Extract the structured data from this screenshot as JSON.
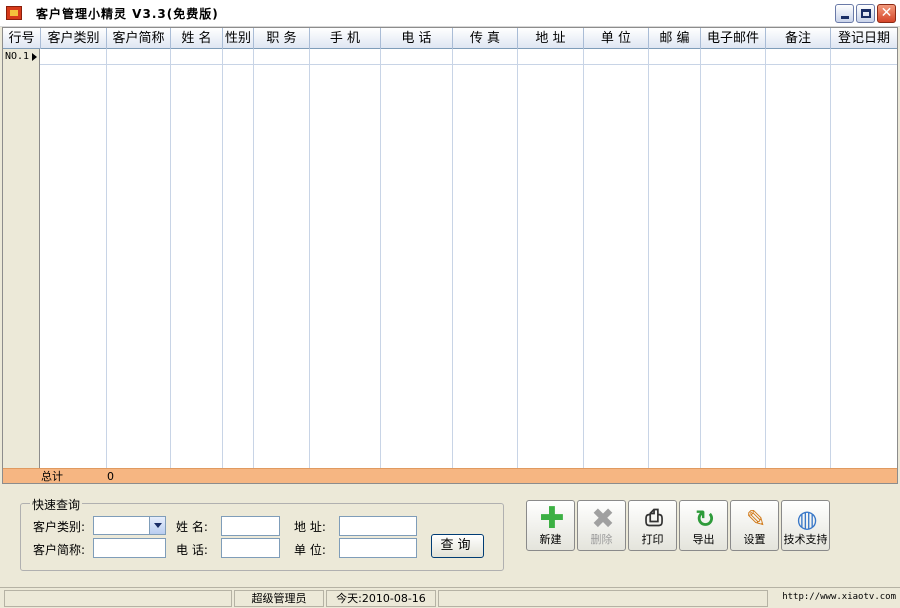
{
  "window": {
    "title": "客户管理小精灵 V3.3(免费版)",
    "icon": "app-icon",
    "controls": [
      "minimize-icon",
      "maximize-icon",
      "close-icon"
    ]
  },
  "grid": {
    "columns": [
      "行号",
      "客户类别",
      "客户简称",
      "姓 名",
      "性别",
      "职 务",
      "手 机",
      "电 话",
      "传 真",
      "地 址",
      "单 位",
      "邮 编",
      "电子邮件",
      "备注",
      "登记日期"
    ],
    "rows": [
      {
        "row_label": "NO.1"
      }
    ],
    "total": {
      "label": "总计",
      "value": "0"
    }
  },
  "query": {
    "legend": "快速查询",
    "category_label": "客户类别:",
    "category_value": "",
    "name_label": "姓 名:",
    "name_value": "",
    "address_label": "地 址:",
    "address_value": "",
    "shortname_label": "客户简称:",
    "shortname_value": "",
    "phone_label": "电 话:",
    "phone_value": "",
    "company_label": "单 位:",
    "company_value": "",
    "search_button": "查询"
  },
  "toolbar": {
    "new": "新建",
    "delete": "删除",
    "print": "打印",
    "export": "导出",
    "settings": "设置",
    "support": "技术支持"
  },
  "status": {
    "user": "超级管理员",
    "today": "今天:2010-08-16",
    "url": "http://www.xiaotv.com"
  },
  "colors": {
    "header_gradient_bottom": "#dfe6f2",
    "total_row": "#f6b682",
    "window_bg": "#ece9d8",
    "new_icon": "#3cb043",
    "delete_icon": "#a0a0a0"
  }
}
